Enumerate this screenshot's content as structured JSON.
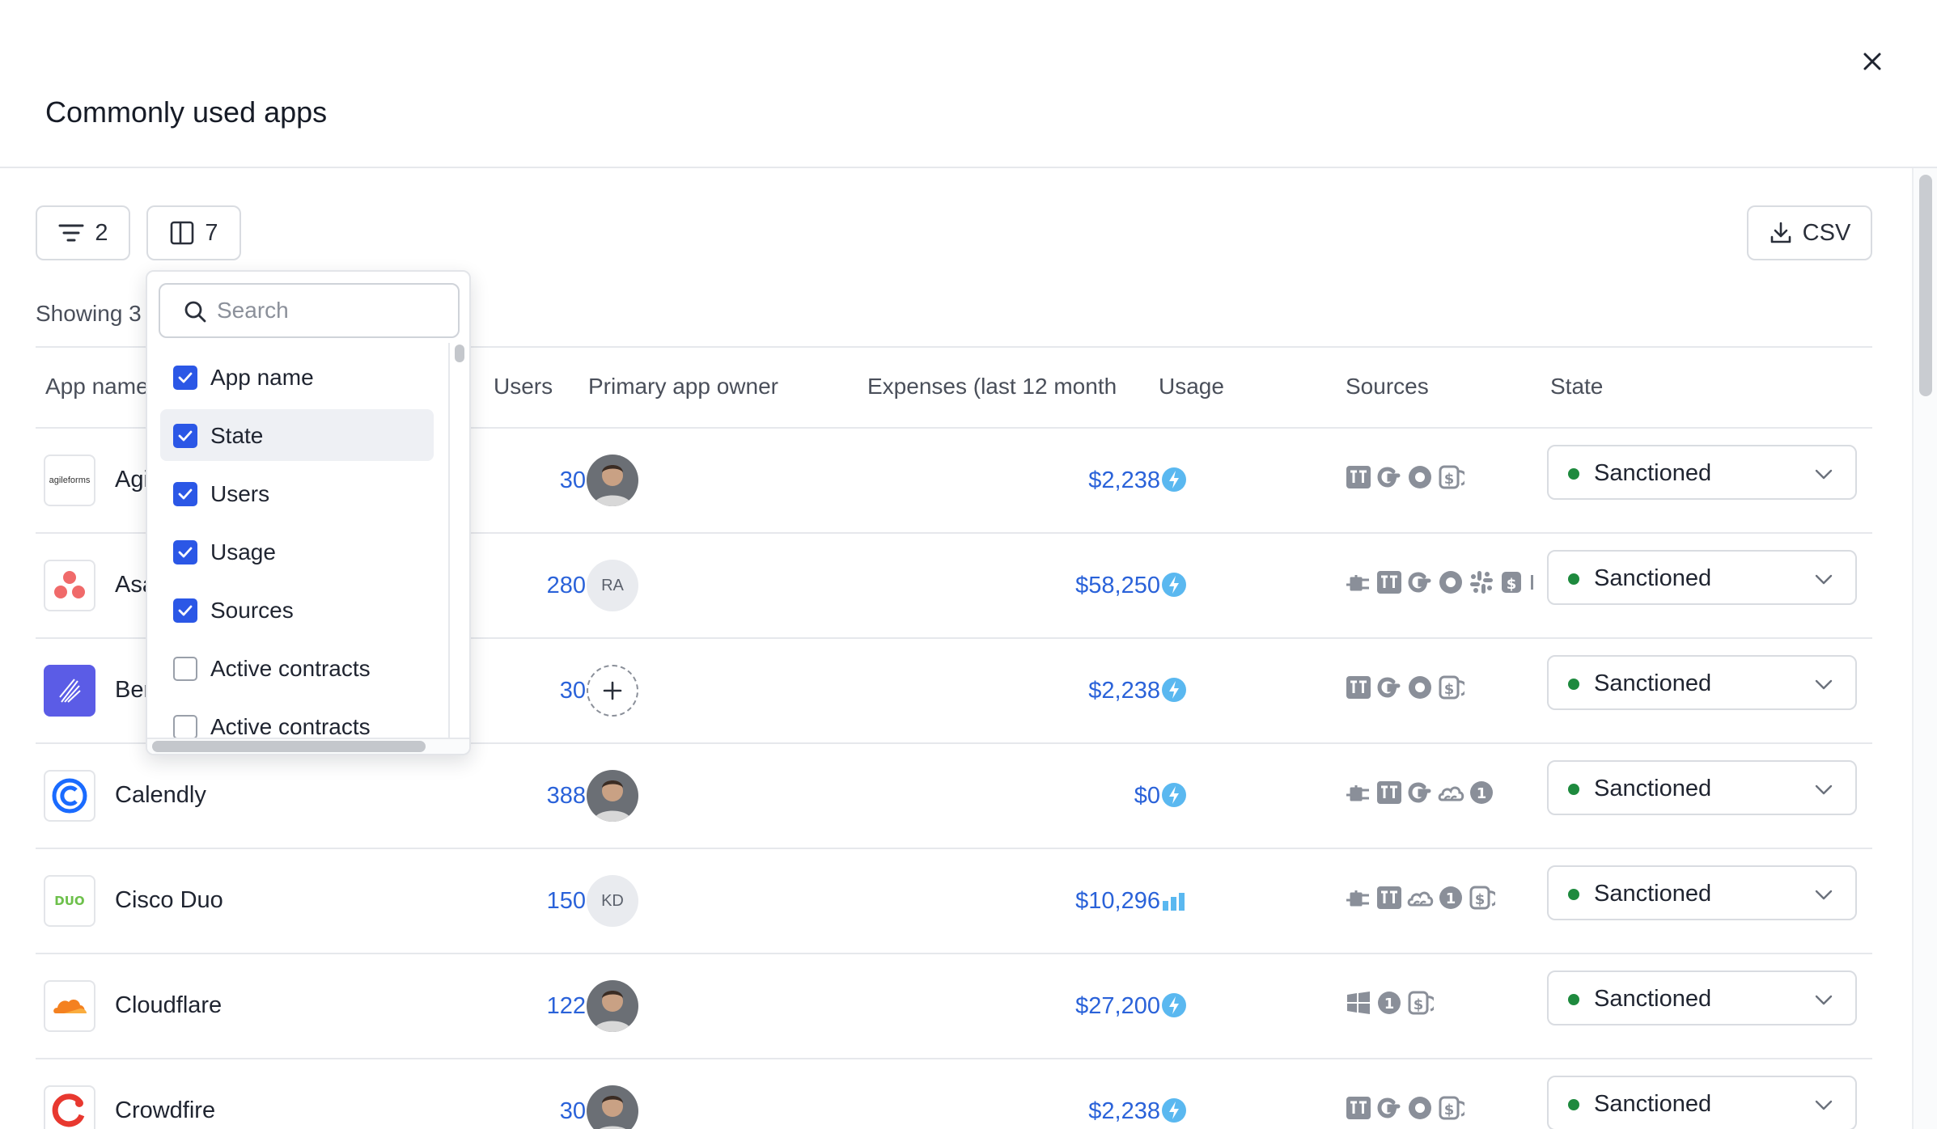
{
  "modal": {
    "title": "Commonly used apps"
  },
  "toolbar": {
    "filter_count": "2",
    "columns_count": "7",
    "csv_label": "CSV"
  },
  "showing_text": "Showing 3",
  "columns": [
    "App name",
    "Users",
    "Primary app owner",
    "Expenses (last 12 month",
    "Usage",
    "Sources",
    "State"
  ],
  "column_picker": {
    "search_placeholder": "Search",
    "items": [
      {
        "label": "App name",
        "checked": true
      },
      {
        "label": "State",
        "checked": true,
        "highlighted": true
      },
      {
        "label": "Users",
        "checked": true
      },
      {
        "label": "Usage",
        "checked": true
      },
      {
        "label": "Sources",
        "checked": true
      },
      {
        "label": "Active contracts",
        "checked": false
      },
      {
        "label": "Active contracts",
        "checked": false
      }
    ]
  },
  "rows": [
    {
      "app": "Agi",
      "logo": "agileforms-logo",
      "logo_text": "agileforms",
      "users": "30",
      "owner": {
        "type": "photo"
      },
      "expense": "$2,238",
      "usage": "active",
      "sources": [
        "tile",
        "google",
        "circle",
        "dollar"
      ],
      "state": "Sanctioned"
    },
    {
      "app": "Asa",
      "logo": "asana-logo",
      "users": "280",
      "owner": {
        "type": "initials",
        "initials": "RA"
      },
      "expense": "$58,250",
      "usage": "active",
      "sources": [
        "plug",
        "tile",
        "google",
        "circle",
        "slack",
        "dollar-solid",
        "more"
      ],
      "state": "Sanctioned"
    },
    {
      "app": "Ber",
      "logo": "bernie-logo",
      "users": "30",
      "owner": {
        "type": "add"
      },
      "expense": "$2,238",
      "usage": "active",
      "sources": [
        "tile",
        "google",
        "circle",
        "dollar"
      ],
      "state": "Sanctioned"
    },
    {
      "app": "Calendly",
      "logo": "calendly-logo",
      "users": "388",
      "owner": {
        "type": "photo"
      },
      "expense": "$0",
      "usage": "active",
      "sources": [
        "plug",
        "tile",
        "google",
        "cloud",
        "one"
      ],
      "state": "Sanctioned"
    },
    {
      "app": "Cisco Duo",
      "logo": "duo-logo",
      "logo_text": "DUO",
      "users": "150",
      "owner": {
        "type": "initials",
        "initials": "KD"
      },
      "expense": "$10,296",
      "usage": "bars",
      "sources": [
        "plug",
        "tile",
        "cloud",
        "one",
        "dollar"
      ],
      "state": "Sanctioned"
    },
    {
      "app": "Cloudflare",
      "logo": "cloudflare-logo",
      "users": "122",
      "owner": {
        "type": "photo"
      },
      "expense": "$27,200",
      "usage": "active",
      "sources": [
        "windows",
        "one",
        "dollar"
      ],
      "state": "Sanctioned"
    },
    {
      "app": "Crowdfire",
      "logo": "crowdfire-logo",
      "users": "30",
      "owner": {
        "type": "photo"
      },
      "expense": "$2,238",
      "usage": "active",
      "sources": [
        "tile",
        "google",
        "circle",
        "dollar"
      ],
      "state": "Sanctioned"
    }
  ],
  "colors": {
    "accent": "#2b57e6",
    "link": "#2a62d9",
    "sanctioned": "#1e8a3e",
    "usage": "#5ab8f0",
    "source_icons": "#8a8f99"
  }
}
